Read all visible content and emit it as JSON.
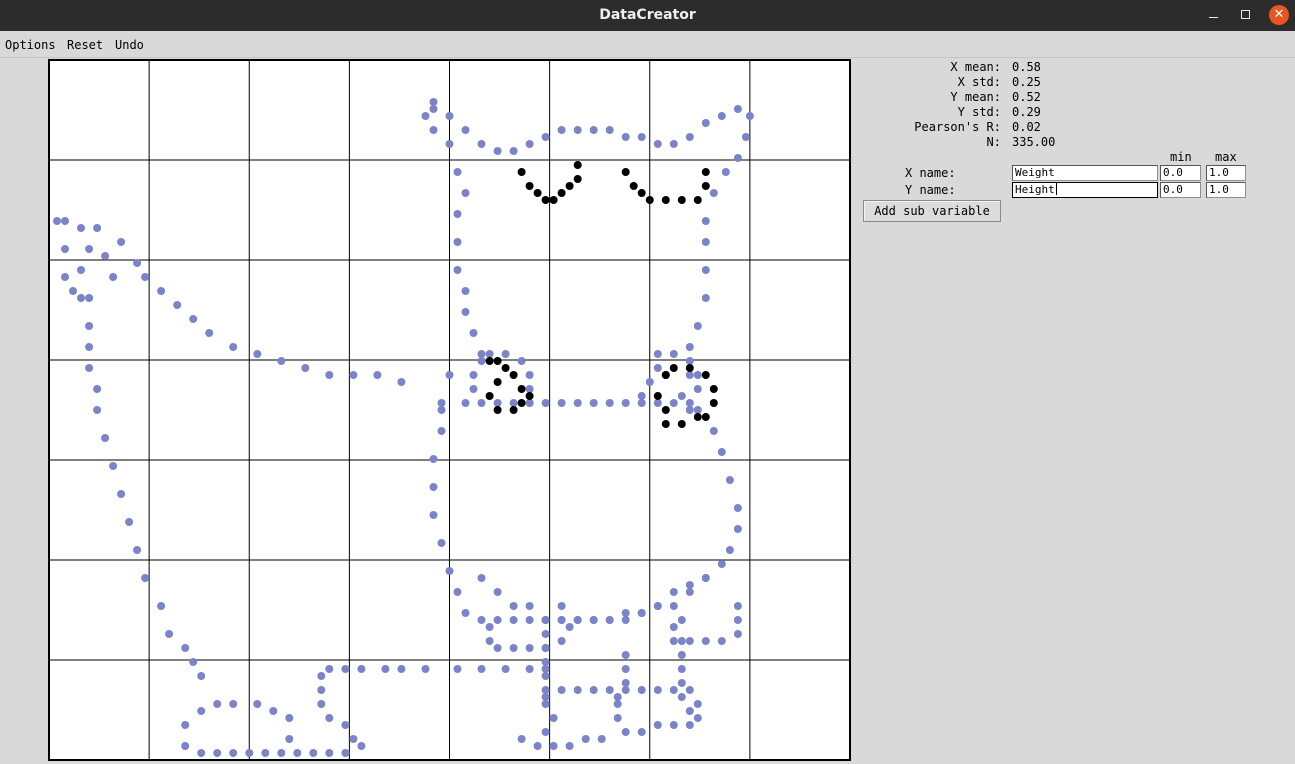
{
  "window": {
    "title": "DataCreator"
  },
  "menu": {
    "options": "Options",
    "reset": "Reset",
    "undo": "Undo"
  },
  "stats": [
    {
      "label": "X mean:",
      "value": "0.58"
    },
    {
      "label": "X std:",
      "value": "0.25"
    },
    {
      "label": "Y mean:",
      "value": "0.52"
    },
    {
      "label": "Y std:",
      "value": "0.29"
    },
    {
      "label": "Pearson's R:",
      "value": "0.02"
    },
    {
      "label": "N:",
      "value": "335.00"
    }
  ],
  "variables": {
    "min_header": "min",
    "max_header": "max",
    "x": {
      "label": "X name:",
      "name": "Weight",
      "min": "0.0",
      "max": "1.0"
    },
    "y": {
      "label": "Y name:",
      "name": "Height",
      "min": "0.0",
      "max": "1.0"
    }
  },
  "add_sub_variable_label": "Add sub variable",
  "colors": {
    "primary_points": "#7b84c9",
    "sub_points": "#000000",
    "grid": "#000000",
    "close_button": "#e95420"
  },
  "chart_data": {
    "type": "scatter",
    "xlim": [
      0,
      1
    ],
    "ylim": [
      0,
      1
    ],
    "grid": true,
    "series": [
      {
        "color": "#7b84c9",
        "points": [
          [
            0.48,
            0.93
          ],
          [
            0.5,
            0.92
          ],
          [
            0.52,
            0.9
          ],
          [
            0.54,
            0.88
          ],
          [
            0.56,
            0.87
          ],
          [
            0.58,
            0.87
          ],
          [
            0.6,
            0.88
          ],
          [
            0.62,
            0.89
          ],
          [
            0.64,
            0.9
          ],
          [
            0.66,
            0.9
          ],
          [
            0.68,
            0.9
          ],
          [
            0.7,
            0.9
          ],
          [
            0.72,
            0.89
          ],
          [
            0.74,
            0.89
          ],
          [
            0.76,
            0.88
          ],
          [
            0.78,
            0.88
          ],
          [
            0.8,
            0.89
          ],
          [
            0.82,
            0.91
          ],
          [
            0.84,
            0.92
          ],
          [
            0.86,
            0.93
          ],
          [
            0.875,
            0.92
          ],
          [
            0.87,
            0.89
          ],
          [
            0.86,
            0.86
          ],
          [
            0.845,
            0.84
          ],
          [
            0.83,
            0.81
          ],
          [
            0.82,
            0.77
          ],
          [
            0.82,
            0.74
          ],
          [
            0.82,
            0.7
          ],
          [
            0.82,
            0.66
          ],
          [
            0.81,
            0.62
          ],
          [
            0.8,
            0.59
          ],
          [
            0.8,
            0.55
          ],
          [
            0.8,
            0.5
          ],
          [
            0.48,
            0.94
          ],
          [
            0.47,
            0.92
          ],
          [
            0.48,
            0.9
          ],
          [
            0.5,
            0.88
          ],
          [
            0.51,
            0.84
          ],
          [
            0.52,
            0.81
          ],
          [
            0.51,
            0.78
          ],
          [
            0.51,
            0.74
          ],
          [
            0.51,
            0.7
          ],
          [
            0.52,
            0.67
          ],
          [
            0.52,
            0.64
          ],
          [
            0.53,
            0.61
          ],
          [
            0.54,
            0.58
          ],
          [
            0.5,
            0.55
          ],
          [
            0.49,
            0.51
          ],
          [
            0.49,
            0.47
          ],
          [
            0.48,
            0.43
          ],
          [
            0.48,
            0.39
          ],
          [
            0.48,
            0.35
          ],
          [
            0.49,
            0.31
          ],
          [
            0.5,
            0.27
          ],
          [
            0.51,
            0.24
          ],
          [
            0.52,
            0.21
          ],
          [
            0.54,
            0.2
          ],
          [
            0.56,
            0.2
          ],
          [
            0.58,
            0.2
          ],
          [
            0.6,
            0.2
          ],
          [
            0.62,
            0.2
          ],
          [
            0.64,
            0.2
          ],
          [
            0.66,
            0.2
          ],
          [
            0.68,
            0.2
          ],
          [
            0.7,
            0.2
          ],
          [
            0.72,
            0.21
          ],
          [
            0.74,
            0.21
          ],
          [
            0.76,
            0.22
          ],
          [
            0.78,
            0.22
          ],
          [
            0.8,
            0.24
          ],
          [
            0.82,
            0.26
          ],
          [
            0.84,
            0.28
          ],
          [
            0.85,
            0.3
          ],
          [
            0.86,
            0.33
          ],
          [
            0.86,
            0.36
          ],
          [
            0.85,
            0.4
          ],
          [
            0.84,
            0.44
          ],
          [
            0.83,
            0.47
          ],
          [
            0.81,
            0.5
          ],
          [
            0.79,
            0.52
          ],
          [
            0.49,
            0.5
          ],
          [
            0.52,
            0.51
          ],
          [
            0.54,
            0.51
          ],
          [
            0.56,
            0.51
          ],
          [
            0.58,
            0.51
          ],
          [
            0.6,
            0.51
          ],
          [
            0.62,
            0.51
          ],
          [
            0.64,
            0.51
          ],
          [
            0.66,
            0.51
          ],
          [
            0.68,
            0.51
          ],
          [
            0.7,
            0.51
          ],
          [
            0.72,
            0.51
          ],
          [
            0.74,
            0.51
          ],
          [
            0.76,
            0.51
          ],
          [
            0.78,
            0.51
          ],
          [
            0.8,
            0.51
          ],
          [
            0.54,
            0.57
          ],
          [
            0.53,
            0.55
          ],
          [
            0.53,
            0.53
          ],
          [
            0.55,
            0.58
          ],
          [
            0.57,
            0.58
          ],
          [
            0.59,
            0.57
          ],
          [
            0.6,
            0.55
          ],
          [
            0.6,
            0.53
          ],
          [
            0.6,
            0.51
          ],
          [
            0.76,
            0.58
          ],
          [
            0.78,
            0.58
          ],
          [
            0.8,
            0.57
          ],
          [
            0.81,
            0.55
          ],
          [
            0.81,
            0.53
          ],
          [
            0.76,
            0.56
          ],
          [
            0.75,
            0.54
          ],
          [
            0.74,
            0.52
          ],
          [
            0.54,
            0.26
          ],
          [
            0.56,
            0.24
          ],
          [
            0.58,
            0.22
          ],
          [
            0.6,
            0.22
          ],
          [
            0.62,
            0.2
          ],
          [
            0.64,
            0.2
          ],
          [
            0.66,
            0.2
          ],
          [
            0.68,
            0.2
          ],
          [
            0.7,
            0.2
          ],
          [
            0.72,
            0.2
          ],
          [
            0.74,
            0.21
          ],
          [
            0.76,
            0.22
          ],
          [
            0.78,
            0.24
          ],
          [
            0.8,
            0.25
          ],
          [
            0.82,
            0.26
          ],
          [
            0.55,
            0.19
          ],
          [
            0.55,
            0.17
          ],
          [
            0.56,
            0.16
          ],
          [
            0.58,
            0.16
          ],
          [
            0.6,
            0.16
          ],
          [
            0.62,
            0.16
          ],
          [
            0.64,
            0.17
          ],
          [
            0.65,
            0.19
          ],
          [
            0.64,
            0.22
          ],
          [
            0.78,
            0.19
          ],
          [
            0.78,
            0.17
          ],
          [
            0.8,
            0.17
          ],
          [
            0.82,
            0.17
          ],
          [
            0.84,
            0.17
          ],
          [
            0.86,
            0.18
          ],
          [
            0.86,
            0.2
          ],
          [
            0.86,
            0.22
          ],
          [
            0.62,
            0.2
          ],
          [
            0.62,
            0.18
          ],
          [
            0.62,
            0.16
          ],
          [
            0.62,
            0.14
          ],
          [
            0.62,
            0.12
          ],
          [
            0.62,
            0.1
          ],
          [
            0.62,
            0.08
          ],
          [
            0.63,
            0.06
          ],
          [
            0.62,
            0.04
          ],
          [
            0.79,
            0.2
          ],
          [
            0.79,
            0.17
          ],
          [
            0.79,
            0.15
          ],
          [
            0.79,
            0.13
          ],
          [
            0.79,
            0.11
          ],
          [
            0.79,
            0.09
          ],
          [
            0.8,
            0.07
          ],
          [
            0.72,
            0.15
          ],
          [
            0.72,
            0.13
          ],
          [
            0.72,
            0.11
          ],
          [
            0.71,
            0.09
          ],
          [
            0.62,
            0.09
          ],
          [
            0.64,
            0.1
          ],
          [
            0.66,
            0.1
          ],
          [
            0.68,
            0.1
          ],
          [
            0.7,
            0.1
          ],
          [
            0.72,
            0.1
          ],
          [
            0.74,
            0.1
          ],
          [
            0.76,
            0.1
          ],
          [
            0.78,
            0.1
          ],
          [
            0.8,
            0.1
          ],
          [
            0.81,
            0.08
          ],
          [
            0.81,
            0.06
          ],
          [
            0.8,
            0.05
          ],
          [
            0.78,
            0.05
          ],
          [
            0.76,
            0.05
          ],
          [
            0.74,
            0.04
          ],
          [
            0.72,
            0.04
          ],
          [
            0.71,
            0.06
          ],
          [
            0.71,
            0.08
          ],
          [
            0.69,
            0.03
          ],
          [
            0.67,
            0.03
          ],
          [
            0.65,
            0.02
          ],
          [
            0.63,
            0.02
          ],
          [
            0.61,
            0.02
          ],
          [
            0.59,
            0.03
          ],
          [
            0.35,
            0.13
          ],
          [
            0.37,
            0.13
          ],
          [
            0.39,
            0.13
          ],
          [
            0.42,
            0.13
          ],
          [
            0.44,
            0.13
          ],
          [
            0.47,
            0.13
          ],
          [
            0.51,
            0.13
          ],
          [
            0.54,
            0.13
          ],
          [
            0.57,
            0.13
          ],
          [
            0.6,
            0.13
          ],
          [
            0.62,
            0.13
          ],
          [
            0.34,
            0.12
          ],
          [
            0.34,
            0.1
          ],
          [
            0.34,
            0.08
          ],
          [
            0.35,
            0.06
          ],
          [
            0.37,
            0.05
          ],
          [
            0.38,
            0.03
          ],
          [
            0.39,
            0.02
          ],
          [
            0.37,
            0.01
          ],
          [
            0.35,
            0.01
          ],
          [
            0.33,
            0.01
          ],
          [
            0.31,
            0.01
          ],
          [
            0.29,
            0.01
          ],
          [
            0.27,
            0.01
          ],
          [
            0.25,
            0.01
          ],
          [
            0.23,
            0.01
          ],
          [
            0.21,
            0.01
          ],
          [
            0.19,
            0.01
          ],
          [
            0.17,
            0.02
          ],
          [
            0.17,
            0.05
          ],
          [
            0.19,
            0.07
          ],
          [
            0.21,
            0.08
          ],
          [
            0.23,
            0.08
          ],
          [
            0.26,
            0.08
          ],
          [
            0.28,
            0.07
          ],
          [
            0.3,
            0.06
          ],
          [
            0.3,
            0.03
          ],
          [
            0.02,
            0.77
          ],
          [
            0.04,
            0.76
          ],
          [
            0.06,
            0.76
          ],
          [
            0.09,
            0.74
          ],
          [
            0.11,
            0.71
          ],
          [
            0.12,
            0.69
          ],
          [
            0.14,
            0.67
          ],
          [
            0.16,
            0.65
          ],
          [
            0.18,
            0.63
          ],
          [
            0.2,
            0.61
          ],
          [
            0.23,
            0.59
          ],
          [
            0.26,
            0.58
          ],
          [
            0.29,
            0.57
          ],
          [
            0.32,
            0.56
          ],
          [
            0.35,
            0.55
          ],
          [
            0.38,
            0.55
          ],
          [
            0.41,
            0.55
          ],
          [
            0.44,
            0.54
          ],
          [
            0.01,
            0.77
          ],
          [
            0.02,
            0.73
          ],
          [
            0.02,
            0.69
          ],
          [
            0.03,
            0.67
          ],
          [
            0.04,
            0.66
          ],
          [
            0.05,
            0.66
          ],
          [
            0.04,
            0.7
          ],
          [
            0.05,
            0.73
          ],
          [
            0.07,
            0.72
          ],
          [
            0.08,
            0.69
          ],
          [
            0.05,
            0.62
          ],
          [
            0.05,
            0.59
          ],
          [
            0.05,
            0.56
          ],
          [
            0.06,
            0.53
          ],
          [
            0.06,
            0.5
          ],
          [
            0.07,
            0.46
          ],
          [
            0.08,
            0.42
          ],
          [
            0.09,
            0.38
          ],
          [
            0.1,
            0.34
          ],
          [
            0.11,
            0.3
          ],
          [
            0.12,
            0.26
          ],
          [
            0.14,
            0.22
          ],
          [
            0.15,
            0.18
          ],
          [
            0.17,
            0.16
          ],
          [
            0.18,
            0.14
          ],
          [
            0.19,
            0.12
          ]
        ]
      },
      {
        "color": "#000000",
        "points": [
          [
            0.59,
            0.84
          ],
          [
            0.6,
            0.82
          ],
          [
            0.61,
            0.81
          ],
          [
            0.62,
            0.8
          ],
          [
            0.63,
            0.8
          ],
          [
            0.64,
            0.81
          ],
          [
            0.65,
            0.82
          ],
          [
            0.66,
            0.83
          ],
          [
            0.66,
            0.85
          ],
          [
            0.72,
            0.84
          ],
          [
            0.73,
            0.82
          ],
          [
            0.74,
            0.81
          ],
          [
            0.75,
            0.8
          ],
          [
            0.77,
            0.8
          ],
          [
            0.79,
            0.8
          ],
          [
            0.81,
            0.8
          ],
          [
            0.82,
            0.82
          ],
          [
            0.82,
            0.84
          ],
          [
            0.55,
            0.57
          ],
          [
            0.56,
            0.57
          ],
          [
            0.57,
            0.56
          ],
          [
            0.56,
            0.54
          ],
          [
            0.55,
            0.52
          ],
          [
            0.56,
            0.5
          ],
          [
            0.58,
            0.5
          ],
          [
            0.59,
            0.51
          ],
          [
            0.6,
            0.52
          ],
          [
            0.59,
            0.53
          ],
          [
            0.58,
            0.55
          ],
          [
            0.77,
            0.55
          ],
          [
            0.78,
            0.56
          ],
          [
            0.8,
            0.56
          ],
          [
            0.82,
            0.55
          ],
          [
            0.83,
            0.53
          ],
          [
            0.83,
            0.51
          ],
          [
            0.82,
            0.49
          ],
          [
            0.81,
            0.49
          ],
          [
            0.79,
            0.48
          ],
          [
            0.77,
            0.48
          ],
          [
            0.77,
            0.5
          ],
          [
            0.76,
            0.52
          ],
          [
            0.77,
            0.55
          ]
        ]
      }
    ]
  }
}
